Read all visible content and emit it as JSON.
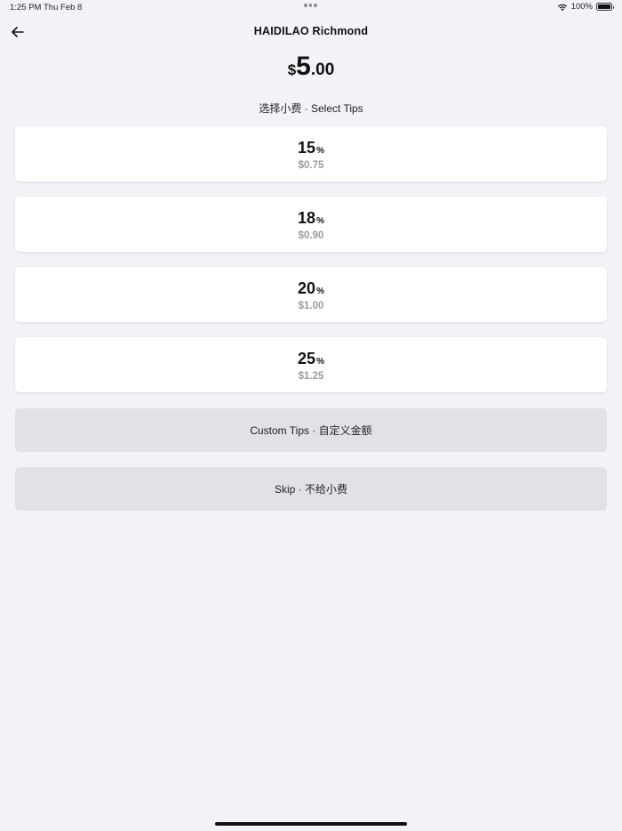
{
  "status_bar": {
    "time": "1:25 PM",
    "date": "Thu Feb 8",
    "battery": "100%"
  },
  "header": {
    "title": "HAIDILAO Richmond"
  },
  "amount": {
    "currency": "$",
    "whole": "5",
    "cents": ".00"
  },
  "section_label": "选择小费 · Select Tips",
  "tip_options": [
    {
      "percent": "15",
      "sign": "%",
      "amount": "$0.75"
    },
    {
      "percent": "18",
      "sign": "%",
      "amount": "$0.90"
    },
    {
      "percent": "20",
      "sign": "%",
      "amount": "$1.00"
    },
    {
      "percent": "25",
      "sign": "%",
      "amount": "$1.25"
    }
  ],
  "buttons": {
    "custom_tips": "Custom Tips · 自定义金额",
    "skip": "Skip · 不给小费"
  },
  "colors": {
    "background": "#f2f2f7",
    "card": "#ffffff",
    "secondary_button": "#e2e1e7",
    "muted_text": "#9a9a9f"
  },
  "icons": {
    "back": "arrow-left-icon",
    "wifi": "wifi-icon",
    "battery": "battery-icon"
  }
}
